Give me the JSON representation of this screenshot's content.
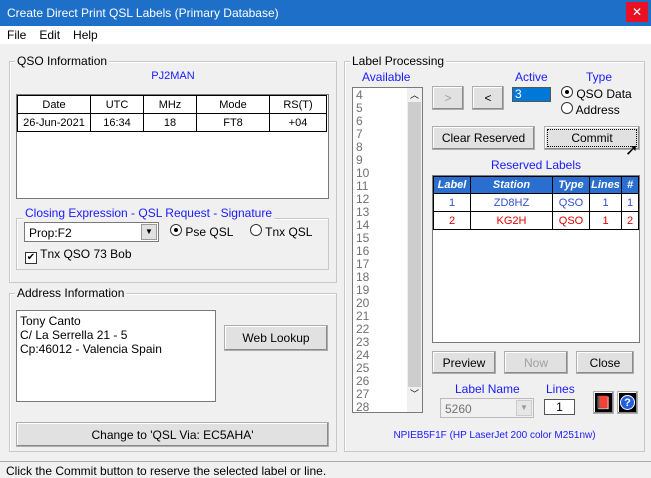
{
  "window": {
    "title": "Create Direct Print QSL Labels (Primary Database)",
    "close": "✕"
  },
  "menu": [
    "File",
    "Edit",
    "Help"
  ],
  "qso": {
    "legend": "QSO Information",
    "callsign": "PJ2MAN",
    "headers": [
      "Date",
      "UTC",
      "MHz",
      "Mode",
      "RS(T)"
    ],
    "row": [
      "26-Jun-2021",
      "16:34",
      "18",
      "FT8",
      "+04"
    ]
  },
  "closing": {
    "legend": "Closing Expression - QSL Request - Signature",
    "select_value": "Prop:F2",
    "radio1": "Pse QSL",
    "radio2": "Tnx QSL",
    "radio_selected": "Pse QSL",
    "checkbox_label": "Tnx QSO 73 Bob",
    "checkbox_checked": true
  },
  "address": {
    "legend": "Address Information",
    "lines": [
      "Tony Canto",
      "C/ La Serrella 21 - 5",
      "Cp:46012 - Valencia Spain"
    ],
    "web_lookup": "Web Lookup",
    "change_via": "Change to 'QSL Via: EC5AHA'"
  },
  "label": {
    "legend": "Label Processing",
    "available": "Available",
    "available_items": [
      "4",
      "5",
      "6",
      "7",
      "8",
      "9",
      "10",
      "11",
      "12",
      "13",
      "14",
      "15",
      "16",
      "17",
      "18",
      "19",
      "20",
      "21",
      "22",
      "23",
      "24",
      "25",
      "26",
      "27",
      "28"
    ],
    "add": ">",
    "remove": "<",
    "active_label": "Active",
    "active_value": "3",
    "type_label": "Type",
    "type_opt1": "QSO Data",
    "type_opt2": "Address",
    "type_selected": "QSO Data",
    "clear_reserved": "Clear Reserved",
    "commit": "Commit",
    "reserved_title": "Reserved Labels",
    "reserved_headers": [
      "Label",
      "Station",
      "Type",
      "Lines",
      "#"
    ],
    "reserved_rows": [
      {
        "cells": [
          "1",
          "ZD8HZ",
          "QSO",
          "1",
          "1"
        ],
        "color": "#3050d0"
      },
      {
        "cells": [
          "2",
          "KG2H",
          "QSO",
          "1",
          "2"
        ],
        "color": "#e00000"
      }
    ],
    "preview": "Preview",
    "now": "Now",
    "close": "Close",
    "label_name_label": "Label Name",
    "label_name_value": "5260",
    "lines_label": "Lines",
    "lines_value": "1",
    "printer": "NPIEB5F1F (HP LaserJet 200 color M251nw)"
  },
  "status": "Click the Commit button to reserve the selected label or line."
}
